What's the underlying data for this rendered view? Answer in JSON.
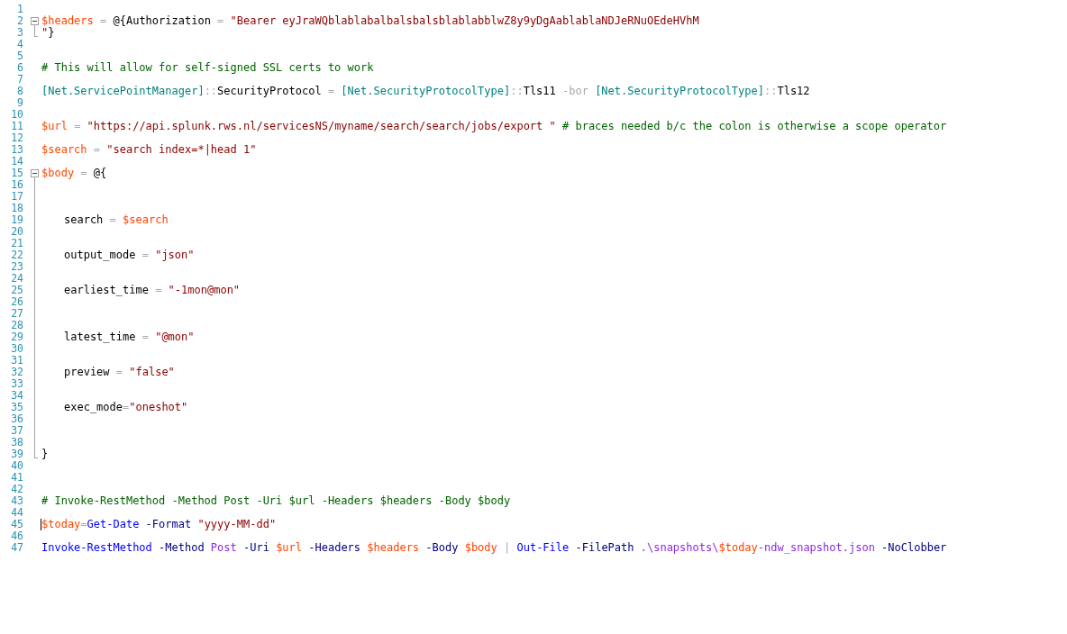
{
  "editor": {
    "lines": [
      {
        "number": "1",
        "kind": "plain"
      },
      {
        "number": "2",
        "kind": "foldstart",
        "tokens": [
          {
            "kind": "variable",
            "text": "$headers"
          },
          {
            "kind": "operator",
            "text": " = "
          },
          {
            "kind": "plain",
            "text": "@{Authorization"
          },
          {
            "kind": "operator",
            "text": " = "
          },
          {
            "kind": "string",
            "text": "\"Bearer eyJraWQblablabalbalsbalsblablabblwZ8y9yDgAablablaNDJeRNuOEdeHVhM"
          }
        ]
      },
      {
        "number": "3",
        "kind": "foldend",
        "tokens": [
          {
            "kind": "string",
            "text": "\""
          },
          {
            "kind": "plain",
            "text": "}"
          }
        ]
      },
      {
        "number": "4",
        "kind": "plain"
      },
      {
        "number": "5",
        "kind": "plain"
      },
      {
        "number": "6",
        "kind": "plain",
        "tokens": [
          {
            "kind": "comment",
            "text": "# This will allow for self-signed SSL certs to work"
          }
        ]
      },
      {
        "number": "7",
        "kind": "plain"
      },
      {
        "number": "8",
        "kind": "plain",
        "tokens": [
          {
            "kind": "type",
            "text": "[Net.ServicePointManager]"
          },
          {
            "kind": "operator",
            "text": "::"
          },
          {
            "kind": "plain",
            "text": "SecurityProtocol"
          },
          {
            "kind": "operator",
            "text": " = "
          },
          {
            "kind": "type",
            "text": "[Net.SecurityProtocolType]"
          },
          {
            "kind": "operator",
            "text": "::"
          },
          {
            "kind": "plain",
            "text": "Tls11"
          },
          {
            "kind": "operator",
            "text": " -bor "
          },
          {
            "kind": "type",
            "text": "[Net.SecurityProtocolType]"
          },
          {
            "kind": "operator",
            "text": "::"
          },
          {
            "kind": "plain",
            "text": "Tls12"
          }
        ]
      },
      {
        "number": "9",
        "kind": "plain"
      },
      {
        "number": "10",
        "kind": "plain"
      },
      {
        "number": "11",
        "kind": "plain",
        "tokens": [
          {
            "kind": "variable",
            "text": "$url"
          },
          {
            "kind": "operator",
            "text": " = "
          },
          {
            "kind": "string",
            "text": "\"https://api.splunk.rws.nl/servicesNS/myname/search/search/jobs/export \""
          },
          {
            "kind": "comment",
            "text": " # braces needed b/c the colon is otherwise a scope operator"
          }
        ]
      },
      {
        "number": "12",
        "kind": "plain"
      },
      {
        "number": "13",
        "kind": "plain",
        "tokens": [
          {
            "kind": "variable",
            "text": "$search"
          },
          {
            "kind": "operator",
            "text": " = "
          },
          {
            "kind": "string",
            "text": "\"search index=*|head 1\""
          }
        ]
      },
      {
        "number": "14",
        "kind": "plain"
      },
      {
        "number": "15",
        "kind": "foldstart",
        "tokens": [
          {
            "kind": "variable",
            "text": "$body"
          },
          {
            "kind": "operator",
            "text": " = "
          },
          {
            "kind": "plain",
            "text": "@{"
          }
        ]
      },
      {
        "number": "16",
        "kind": "foldbody"
      },
      {
        "number": "17",
        "kind": "foldbody"
      },
      {
        "number": "18",
        "kind": "foldbody"
      },
      {
        "number": "19",
        "kind": "foldbody",
        "indented": true,
        "tokens": [
          {
            "kind": "plain",
            "text": "search"
          },
          {
            "kind": "operator",
            "text": " = "
          },
          {
            "kind": "variable",
            "text": "$search"
          }
        ]
      },
      {
        "number": "20",
        "kind": "foldbody"
      },
      {
        "number": "21",
        "kind": "foldbody"
      },
      {
        "number": "22",
        "kind": "foldbody",
        "indented": true,
        "tokens": [
          {
            "kind": "plain",
            "text": "output_mode"
          },
          {
            "kind": "operator",
            "text": " = "
          },
          {
            "kind": "string",
            "text": "\"json\""
          }
        ]
      },
      {
        "number": "23",
        "kind": "foldbody"
      },
      {
        "number": "24",
        "kind": "foldbody"
      },
      {
        "number": "25",
        "kind": "foldbody",
        "indented": true,
        "tokens": [
          {
            "kind": "plain",
            "text": "earliest_time"
          },
          {
            "kind": "operator",
            "text": " = "
          },
          {
            "kind": "string",
            "text": "\"-1mon@mon\""
          }
        ]
      },
      {
        "number": "26",
        "kind": "foldbody"
      },
      {
        "number": "27",
        "kind": "foldbody"
      },
      {
        "number": "28",
        "kind": "foldbody"
      },
      {
        "number": "29",
        "kind": "foldbody",
        "indented": true,
        "tokens": [
          {
            "kind": "plain",
            "text": "latest_time"
          },
          {
            "kind": "operator",
            "text": " = "
          },
          {
            "kind": "string",
            "text": "\"@mon\""
          }
        ]
      },
      {
        "number": "30",
        "kind": "foldbody"
      },
      {
        "number": "31",
        "kind": "foldbody"
      },
      {
        "number": "32",
        "kind": "foldbody",
        "indented": true,
        "tokens": [
          {
            "kind": "plain",
            "text": "preview"
          },
          {
            "kind": "operator",
            "text": " = "
          },
          {
            "kind": "string",
            "text": "\"false\""
          }
        ]
      },
      {
        "number": "33",
        "kind": "foldbody"
      },
      {
        "number": "34",
        "kind": "foldbody"
      },
      {
        "number": "35",
        "kind": "foldbody",
        "indented": true,
        "tokens": [
          {
            "kind": "plain",
            "text": "exec_mode"
          },
          {
            "kind": "operator",
            "text": "="
          },
          {
            "kind": "string",
            "text": "\"oneshot\""
          }
        ]
      },
      {
        "number": "36",
        "kind": "foldbody"
      },
      {
        "number": "37",
        "kind": "foldbody"
      },
      {
        "number": "38",
        "kind": "foldbody"
      },
      {
        "number": "39",
        "kind": "foldend",
        "tokens": [
          {
            "kind": "plain",
            "text": "}"
          }
        ]
      },
      {
        "number": "40",
        "kind": "plain"
      },
      {
        "number": "41",
        "kind": "plain"
      },
      {
        "number": "42",
        "kind": "plain"
      },
      {
        "number": "43",
        "kind": "plain",
        "tokens": [
          {
            "kind": "comment",
            "text": "# Invoke-RestMethod -Method Post -Uri $url -Headers $headers -Body $body"
          }
        ]
      },
      {
        "number": "44",
        "kind": "plain"
      },
      {
        "number": "45",
        "kind": "plain",
        "caret": true,
        "tokens": [
          {
            "kind": "variable",
            "text": "$today"
          },
          {
            "kind": "operator",
            "text": "="
          },
          {
            "kind": "command",
            "text": "Get-Date"
          },
          {
            "kind": "parameter",
            "text": " -Format "
          },
          {
            "kind": "string",
            "text": "\"yyyy-MM-dd\""
          }
        ]
      },
      {
        "number": "46",
        "kind": "plain"
      },
      {
        "number": "47",
        "kind": "plain",
        "tokens": [
          {
            "kind": "command",
            "text": "Invoke-RestMethod"
          },
          {
            "kind": "parameter",
            "text": " -Method "
          },
          {
            "kind": "argument",
            "text": "Post"
          },
          {
            "kind": "parameter",
            "text": " -Uri "
          },
          {
            "kind": "variable",
            "text": "$url"
          },
          {
            "kind": "parameter",
            "text": " -Headers "
          },
          {
            "kind": "variable",
            "text": "$headers"
          },
          {
            "kind": "parameter",
            "text": " -Body "
          },
          {
            "kind": "variable",
            "text": "$body"
          },
          {
            "kind": "operator",
            "text": " | "
          },
          {
            "kind": "command",
            "text": "Out-File"
          },
          {
            "kind": "parameter",
            "text": " -FilePath "
          },
          {
            "kind": "argument",
            "text": ".\\snapshots\\"
          },
          {
            "kind": "variable",
            "text": "$today"
          },
          {
            "kind": "argument",
            "text": "-ndw_snapshot.json"
          },
          {
            "kind": "parameter",
            "text": " -NoClobber"
          }
        ]
      }
    ]
  }
}
